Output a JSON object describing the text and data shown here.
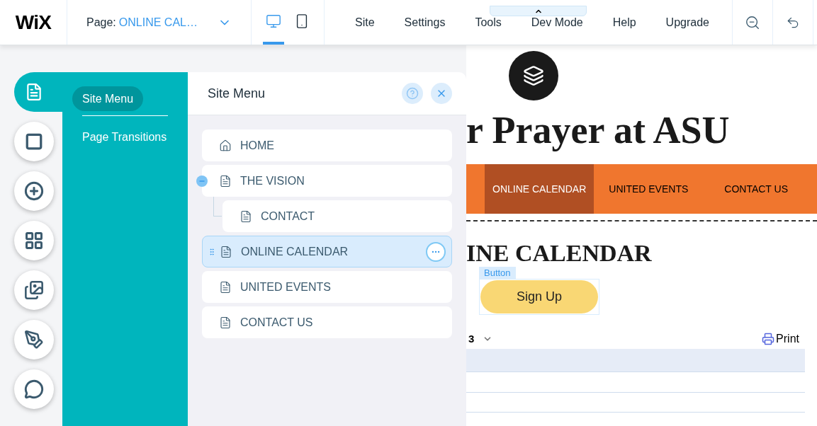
{
  "top_bar": {
    "logo": "WiX",
    "page_selector": {
      "label": "Page:",
      "value": "ONLINE CAL…"
    },
    "views": [
      {
        "kind": "desktop",
        "selected": true
      },
      {
        "kind": "mobile",
        "selected": false
      }
    ],
    "menu": [
      "Site",
      "Settings",
      "Tools",
      "Dev Mode",
      "Help",
      "Upgrade"
    ]
  },
  "tool_rail": [
    {
      "kind": "menus",
      "selected": true
    },
    {
      "kind": "background",
      "selected": false
    },
    {
      "kind": "add",
      "selected": false
    },
    {
      "kind": "apps",
      "selected": false
    },
    {
      "kind": "media",
      "selected": false
    },
    {
      "kind": "pen",
      "selected": false
    },
    {
      "kind": "chat",
      "selected": false
    }
  ],
  "category_panel": [
    {
      "label": "Site Menu",
      "selected": true
    },
    {
      "label": "Page Transitions",
      "selected": false
    }
  ],
  "site_menu": {
    "title": "Site Menu",
    "pages": [
      {
        "label": "HOME",
        "kind": "home",
        "selected": false
      },
      {
        "label": "THE VISION",
        "kind": "page",
        "selected": false,
        "expanded": true,
        "children": [
          {
            "label": "CONTACT",
            "kind": "page",
            "selected": false
          }
        ]
      },
      {
        "label": "ONLINE CALENDAR",
        "kind": "page",
        "selected": true
      },
      {
        "label": "UNITED EVENTS",
        "kind": "page",
        "selected": false
      },
      {
        "label": "CONTACT US",
        "kind": "page",
        "selected": false
      }
    ]
  },
  "site": {
    "title": "r Prayer at ASU",
    "nav": [
      {
        "label": "ONLINE CALENDAR",
        "selected": true
      },
      {
        "label": "UNITED EVENTS",
        "selected": false
      },
      {
        "label": "CONTACT US",
        "selected": false
      }
    ],
    "heading": "INE CALENDAR",
    "selection_tag": "Button",
    "signup": "Sign Up",
    "calendar": {
      "month": "3",
      "print": "Print"
    }
  }
}
